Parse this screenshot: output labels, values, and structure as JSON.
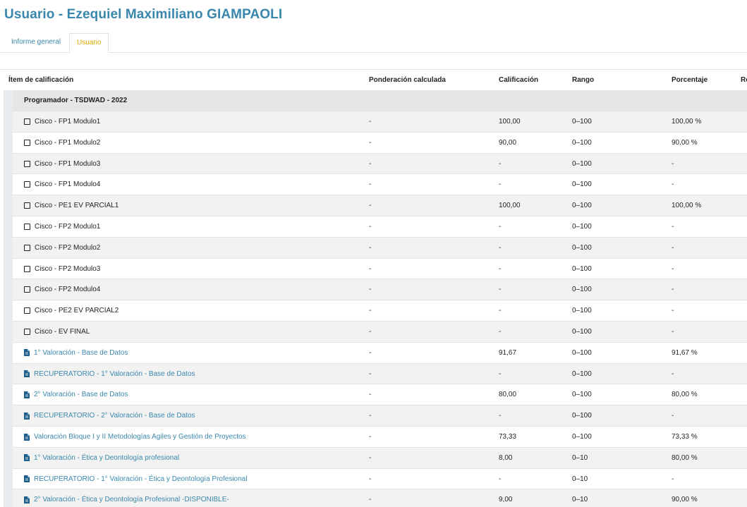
{
  "page_title": "Usuario - Ezequiel Maximiliano GIAMPAOLI",
  "tabs": [
    {
      "label": "Informe general",
      "active": false
    },
    {
      "label": "Usuario",
      "active": true
    }
  ],
  "table": {
    "headers": [
      "Ítem de calificación",
      "Ponderación calculada",
      "Calificación",
      "Rango",
      "Porcentaje",
      "Re"
    ],
    "category": "Programador - TSDWAD - 2022",
    "rows": [
      {
        "name": "Cisco - FP1 Modulo1",
        "icon": "checkbox-icon",
        "link": false,
        "weight": "-",
        "grade": "100,00",
        "range": "0–100",
        "percent": "100,00 %"
      },
      {
        "name": "Cisco - FP1 Modulo2",
        "icon": "checkbox-icon",
        "link": false,
        "weight": "-",
        "grade": "90,00",
        "range": "0–100",
        "percent": "90,00 %"
      },
      {
        "name": "Cisco - FP1 Modulo3",
        "icon": "checkbox-icon",
        "link": false,
        "weight": "-",
        "grade": "-",
        "range": "0–100",
        "percent": "-"
      },
      {
        "name": "Cisco - FP1 Modulo4",
        "icon": "checkbox-icon",
        "link": false,
        "weight": "-",
        "grade": "-",
        "range": "0–100",
        "percent": "-"
      },
      {
        "name": "Cisco - PE1 EV PARCIAL1",
        "icon": "checkbox-icon",
        "link": false,
        "weight": "-",
        "grade": "100,00",
        "range": "0–100",
        "percent": "100,00 %"
      },
      {
        "name": "Cisco - FP2 Modulo1",
        "icon": "checkbox-icon",
        "link": false,
        "weight": "-",
        "grade": "-",
        "range": "0–100",
        "percent": "-"
      },
      {
        "name": "Cisco - FP2 Modulo2",
        "icon": "checkbox-icon",
        "link": false,
        "weight": "-",
        "grade": "-",
        "range": "0–100",
        "percent": "-"
      },
      {
        "name": "Cisco - FP2 Modulo3",
        "icon": "checkbox-icon",
        "link": false,
        "weight": "-",
        "grade": "-",
        "range": "0–100",
        "percent": "-"
      },
      {
        "name": "Cisco - FP2 Modulo4",
        "icon": "checkbox-icon",
        "link": false,
        "weight": "-",
        "grade": "-",
        "range": "0–100",
        "percent": "-"
      },
      {
        "name": "Cisco - PE2 EV PARCIAL2",
        "icon": "checkbox-icon",
        "link": false,
        "weight": "-",
        "grade": "-",
        "range": "0–100",
        "percent": "-"
      },
      {
        "name": "Cisco - EV FINAL",
        "icon": "checkbox-icon",
        "link": false,
        "weight": "-",
        "grade": "-",
        "range": "0–100",
        "percent": "-"
      },
      {
        "name": "1° Valoración - Base de Datos",
        "icon": "assignment-icon",
        "link": true,
        "weight": "-",
        "grade": "91,67",
        "range": "0–100",
        "percent": "91,67 %"
      },
      {
        "name": "RECUPERATORIO - 1° Valoración - Base de Datos",
        "icon": "assignment-icon",
        "link": true,
        "weight": "-",
        "grade": "-",
        "range": "0–100",
        "percent": "-"
      },
      {
        "name": "2° Valoración - Base de Datos",
        "icon": "assignment-icon",
        "link": true,
        "weight": "-",
        "grade": "80,00",
        "range": "0–100",
        "percent": "80,00 %"
      },
      {
        "name": "RECUPERATORIO - 2° Valoración - Base de Datos",
        "icon": "assignment-icon",
        "link": true,
        "weight": "-",
        "grade": "-",
        "range": "0–100",
        "percent": "-"
      },
      {
        "name": "Valoración Bloque I y II Metodologías Agiles y Gestión de Proyectos",
        "icon": "assignment-icon",
        "link": true,
        "weight": "-",
        "grade": "73,33",
        "range": "0–100",
        "percent": "73,33 %"
      },
      {
        "name": "1° Valoración - Ética y Deontología profesional",
        "icon": "assignment-icon",
        "link": true,
        "weight": "-",
        "grade": "8,00",
        "range": "0–10",
        "percent": "80,00 %"
      },
      {
        "name": "RECUPERATORIO - 1° Valoración - Ética y Deontología Profesional",
        "icon": "assignment-icon",
        "link": true,
        "weight": "-",
        "grade": "-",
        "range": "0–10",
        "percent": "-"
      },
      {
        "name": "2° Valoración - Ética y Deontología Profesional -DISPONIBLE-",
        "icon": "assignment-icon",
        "link": true,
        "weight": "-",
        "grade": "9,00",
        "range": "0–10",
        "percent": "90,00 %"
      }
    ]
  },
  "colors": {
    "link": "#3a87ad",
    "active_tab": "#e0a800",
    "title": "#3a87ad"
  }
}
